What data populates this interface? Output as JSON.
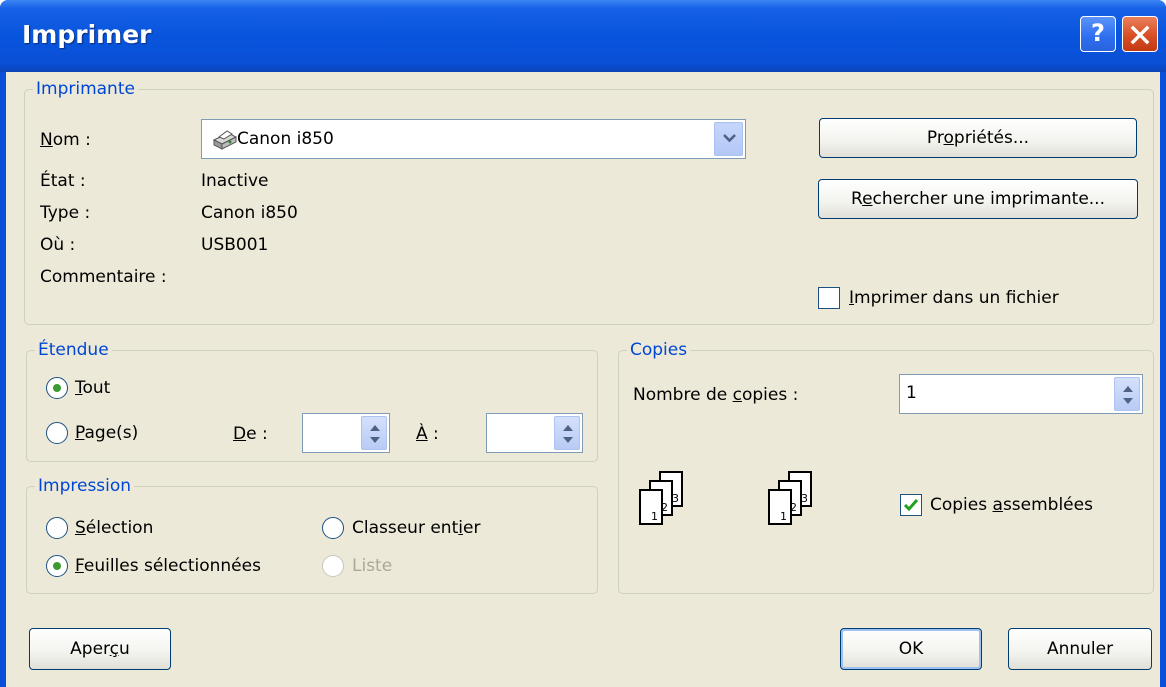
{
  "window": {
    "title": "Imprimer",
    "help_label": "?",
    "close_label": "✕"
  },
  "printer": {
    "legend": "Imprimante",
    "name_label": "Nom :",
    "name_value": "Canon i850",
    "status_label": "État :",
    "status_value": "Inactive",
    "type_label": "Type :",
    "type_value": "Canon i850",
    "where_label": "Où :",
    "where_value": "USB001",
    "comment_label": "Commentaire :",
    "properties_button": "Propriétés...",
    "find_button": "Rechercher une imprimante...",
    "print_to_file_label": "Imprimer dans un fichier",
    "print_to_file_checked": false
  },
  "range": {
    "legend": "Étendue",
    "all_label": "Tout",
    "pages_label": "Page(s)",
    "from_label": "De :",
    "to_label": "À :",
    "from_value": "",
    "to_value": "",
    "selected": "all"
  },
  "print_what": {
    "legend": "Impression",
    "selection_label": "Sélection",
    "entire_workbook_label": "Classeur entier",
    "active_sheets_label": "Feuilles sélectionnées",
    "list_label": "Liste",
    "selected": "active_sheets"
  },
  "copies": {
    "legend": "Copies",
    "number_label": "Nombre de copies :",
    "number_value": "1",
    "collate_label": "Copies assemblées",
    "collate_checked": true,
    "page_numbers": [
      "1",
      "2",
      "3"
    ]
  },
  "footer": {
    "preview_button": "Aperçu",
    "ok_button": "OK",
    "cancel_button": "Annuler"
  },
  "icons": {
    "printer": "printer-icon",
    "combo_arrow": "chevron-down-icon",
    "spin": "spin-arrows-icon",
    "check": "checkmark-icon"
  }
}
